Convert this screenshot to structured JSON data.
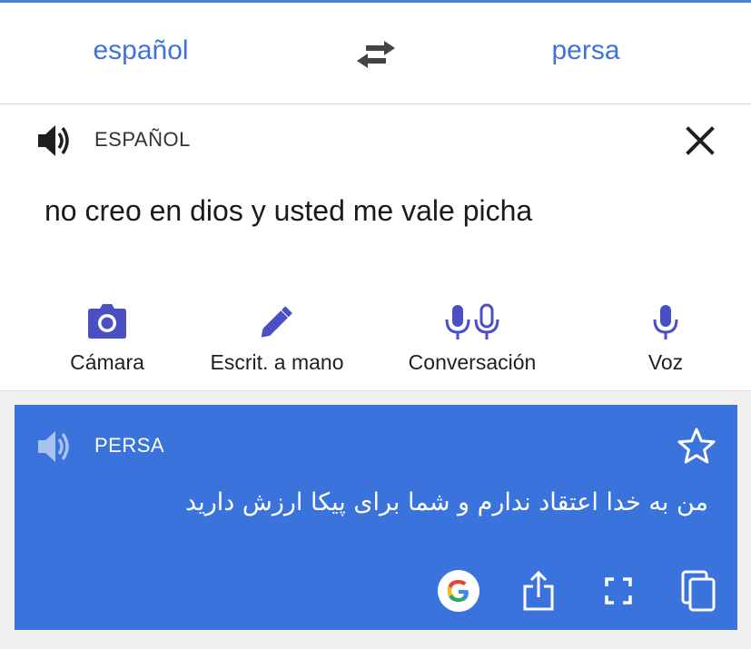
{
  "header": {
    "source_language": "español",
    "target_language": "persa",
    "swap_icon": "swap-arrows-icon"
  },
  "input": {
    "language_label": "ESPAÑOL",
    "text": "no creo en dios y usted me vale picha",
    "speaker_icon": "speaker-icon",
    "close_icon": "close-icon"
  },
  "tools": [
    {
      "label": "Cámara",
      "icon": "camera-icon"
    },
    {
      "label": "Escrit. a mano",
      "icon": "pen-icon"
    },
    {
      "label": "Conversación",
      "icon": "double-mic-icon"
    },
    {
      "label": "Voz",
      "icon": "mic-icon"
    }
  ],
  "result": {
    "language_label": "PERSA",
    "text": "من به خدا اعتقاد ندارم و شما برای پیکا ارزش دارید",
    "actions": [
      "google-icon",
      "share-icon",
      "fullscreen-icon",
      "copy-icon"
    ]
  },
  "colors": {
    "accent": "#3f73d8",
    "result_bg": "#3a73dc",
    "icon_purple": "#4a4fc4"
  }
}
